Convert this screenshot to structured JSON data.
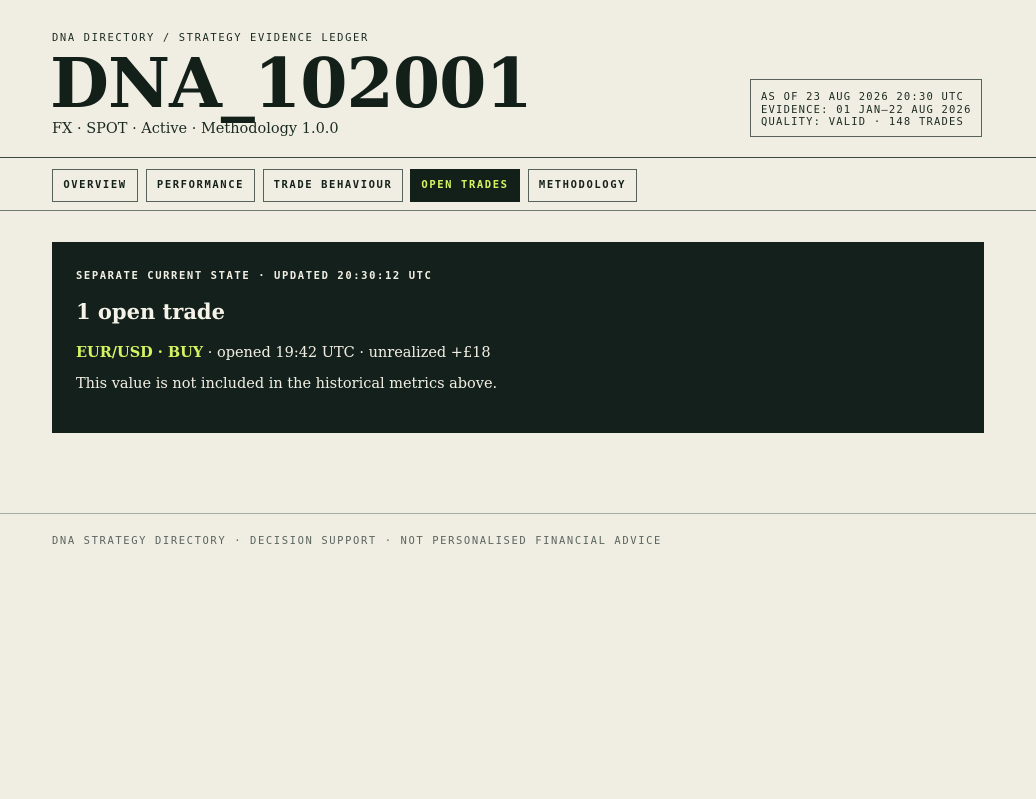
{
  "header": {
    "breadcrumb": "DNA DIRECTORY / STRATEGY EVIDENCE LEDGER",
    "title": "DNA_102001",
    "subtitle": "FX · SPOT · Active · Methodology 1.0.0",
    "meta": {
      "as_of": "AS OF 23 AUG 2026 20:30 UTC",
      "evidence": "EVIDENCE: 01 JAN–22 AUG 2026",
      "quality": "QUALITY: VALID · 148 TRADES"
    }
  },
  "nav": {
    "tabs": [
      {
        "label": "OVERVIEW",
        "active": false
      },
      {
        "label": "PERFORMANCE",
        "active": false
      },
      {
        "label": "TRADE BEHAVIOUR",
        "active": false
      },
      {
        "label": "OPEN TRADES",
        "active": true
      },
      {
        "label": "METHODOLOGY",
        "active": false
      }
    ]
  },
  "open_trades": {
    "label": "SEPARATE CURRENT STATE · UPDATED 20:30:12 UTC",
    "heading": "1 open trade",
    "trade": {
      "pair_side": "EUR/USD · BUY",
      "details": " · opened 19:42 UTC · unrealized +£18"
    },
    "note": "This value is not included in the historical metrics above."
  },
  "footer": {
    "text": "DNA STRATEGY DIRECTORY · DECISION SUPPORT · NOT PERSONALISED FINANCIAL ADVICE"
  },
  "colors": {
    "background": "#f0ede2",
    "ink": "#132019",
    "panel": "#14201b",
    "accent": "#d4f261",
    "muted": "#5b665f"
  }
}
